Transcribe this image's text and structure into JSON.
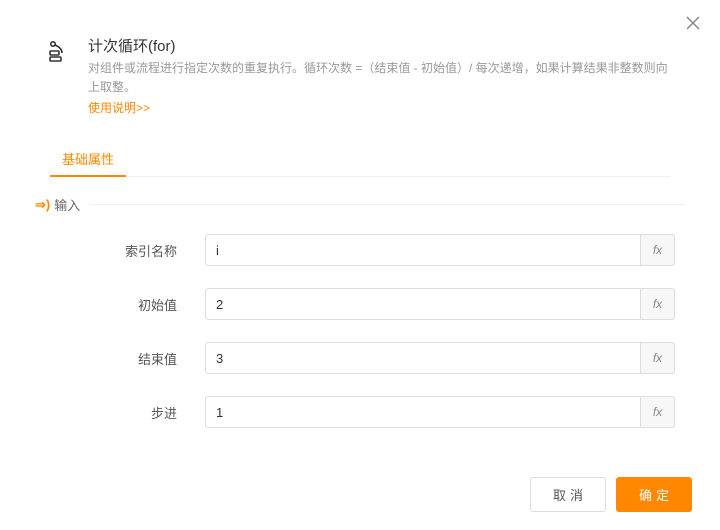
{
  "header": {
    "title": "计次循环(for)",
    "desc": "对组件或流程进行指定次数的重复执行。循环次数 =（结束值 - 初始值）/ 每次递增，如果计算结果非整数则向上取整。",
    "help_link": "使用说明>>"
  },
  "tabs": {
    "basic": "基础属性"
  },
  "section": {
    "input_label": "输入"
  },
  "fields": {
    "index_name": {
      "label": "索引名称",
      "value": "i"
    },
    "start_value": {
      "label": "初始值",
      "value": "2"
    },
    "end_value": {
      "label": "结束值",
      "value": "3"
    },
    "step": {
      "label": "步进",
      "value": "1"
    }
  },
  "fx_label": "fx",
  "buttons": {
    "cancel": "取消",
    "confirm": "确定"
  }
}
